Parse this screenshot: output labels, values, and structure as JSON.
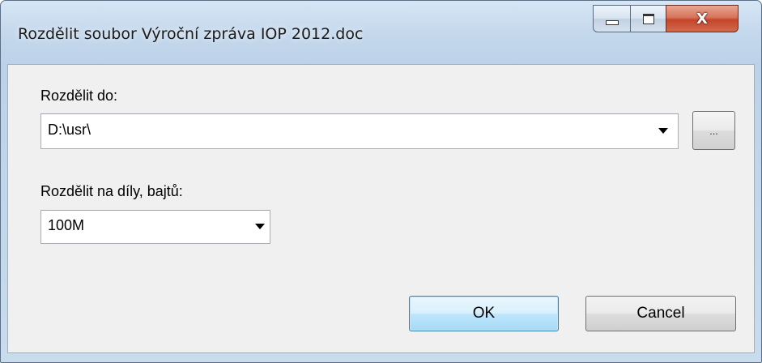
{
  "window": {
    "title": "Rozdělit soubor Výroční zpráva IOP 2012.doc",
    "caption_buttons": {
      "minimize_icon": "minimize-icon",
      "maximize_icon": "maximize-icon",
      "close_glyph": "X"
    }
  },
  "form": {
    "split_to_label": "Rozdělit do:",
    "split_to_value": "D:\\usr\\",
    "browse_label": "...",
    "part_size_label": "Rozdělit na díly, bajtů:",
    "part_size_value": "100M"
  },
  "buttons": {
    "ok_label": "OK",
    "cancel_label": "Cancel"
  },
  "colors": {
    "titlebar": "#c4d8ec",
    "client_background": "#f0f0f0",
    "close_button": "#c4452a",
    "default_button_border": "#3c7fb1"
  }
}
